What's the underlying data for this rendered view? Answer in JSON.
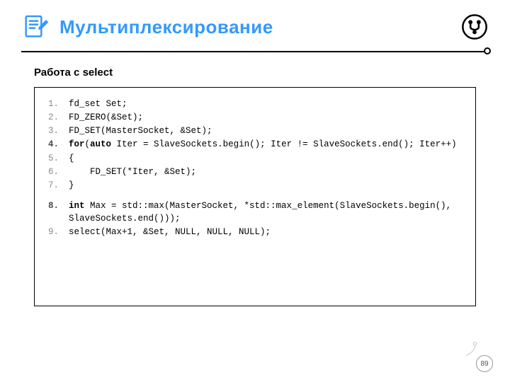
{
  "title": "Мультиплексирование",
  "subtitle": "Работа с select",
  "code": {
    "lines": [
      {
        "n": "1.",
        "strong": false,
        "segments": [
          {
            "t": "fd_set Set;",
            "b": false
          }
        ]
      },
      {
        "n": "2.",
        "strong": false,
        "segments": [
          {
            "t": "FD_ZERO(&Set);",
            "b": false
          }
        ]
      },
      {
        "n": "3.",
        "strong": false,
        "segments": [
          {
            "t": "FD_SET(MasterSocket, &Set);",
            "b": false
          }
        ]
      },
      {
        "n": "4.",
        "strong": true,
        "segments": [
          {
            "t": "for",
            "b": true
          },
          {
            "t": "(",
            "b": false
          },
          {
            "t": "auto",
            "b": true
          },
          {
            "t": " Iter = SlaveSockets.begin(); Iter != SlaveSockets.end(); Iter++)",
            "b": false
          }
        ]
      },
      {
        "n": "5.",
        "strong": false,
        "segments": [
          {
            "t": "{",
            "b": false
          }
        ]
      },
      {
        "n": "6.",
        "strong": false,
        "segments": [
          {
            "t": "    FD_SET(*Iter, &Set);",
            "b": false
          }
        ]
      },
      {
        "n": "7.",
        "strong": false,
        "segments": [
          {
            "t": "}",
            "b": false
          }
        ]
      },
      {
        "gap": true
      },
      {
        "n": "8.",
        "strong": true,
        "segments": [
          {
            "t": "int",
            "b": true
          },
          {
            "t": " Max = std::max(MasterSocket, *std::max_element(SlaveSockets.begin(), SlaveSockets.end()));",
            "b": false
          }
        ]
      },
      {
        "n": "9.",
        "strong": false,
        "segments": [
          {
            "t": "select(Max+1, &Set, NULL, NULL, NULL);",
            "b": false
          }
        ]
      }
    ]
  },
  "page_number": "89"
}
